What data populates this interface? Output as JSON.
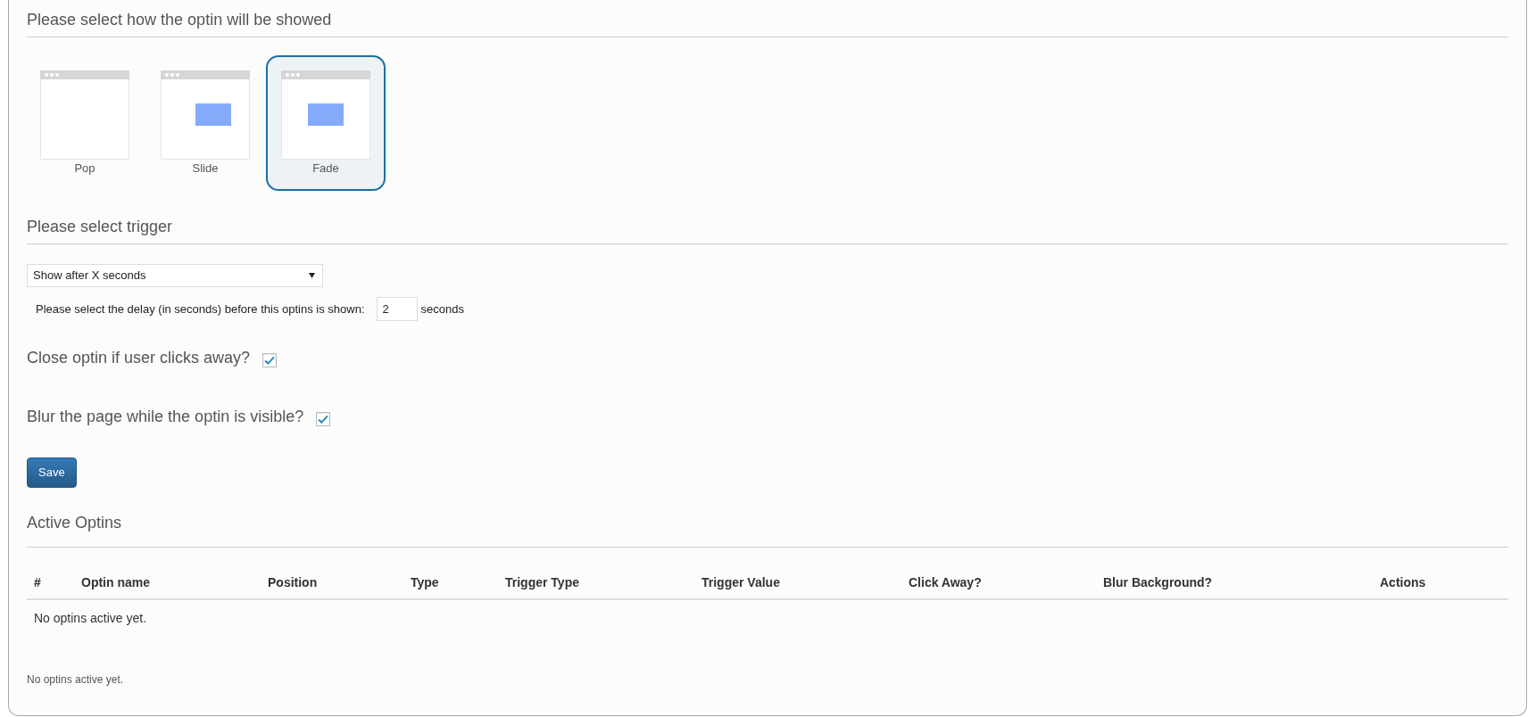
{
  "display_section": {
    "heading": "Please select how the optin will be showed",
    "options": [
      {
        "label": "Pop",
        "kind": "pop",
        "selected": false
      },
      {
        "label": "Slide",
        "kind": "slide",
        "selected": false
      },
      {
        "label": "Fade",
        "kind": "fade",
        "selected": true
      }
    ]
  },
  "trigger_section": {
    "heading": "Please select trigger",
    "trigger_select": {
      "value": "Show after X seconds"
    },
    "delay": {
      "label": "Please select the delay (in seconds) before this optins is shown:",
      "value": "2",
      "unit": "seconds"
    }
  },
  "settings": [
    {
      "label": "Close optin if user clicks away?",
      "checked": true
    },
    {
      "label": "Blur the page while the optin is visible?",
      "checked": true
    }
  ],
  "save_button": {
    "label": "Save"
  },
  "active_optins": {
    "heading": "Active Optins",
    "table": {
      "columns": [
        "#",
        "Optin name",
        "Position",
        "Type",
        "Trigger Type",
        "Trigger Value",
        "Click Away?",
        "Blur Background?",
        "Actions"
      ],
      "empty_message": "No optins active yet."
    },
    "footer_note": "No optins active yet."
  }
}
